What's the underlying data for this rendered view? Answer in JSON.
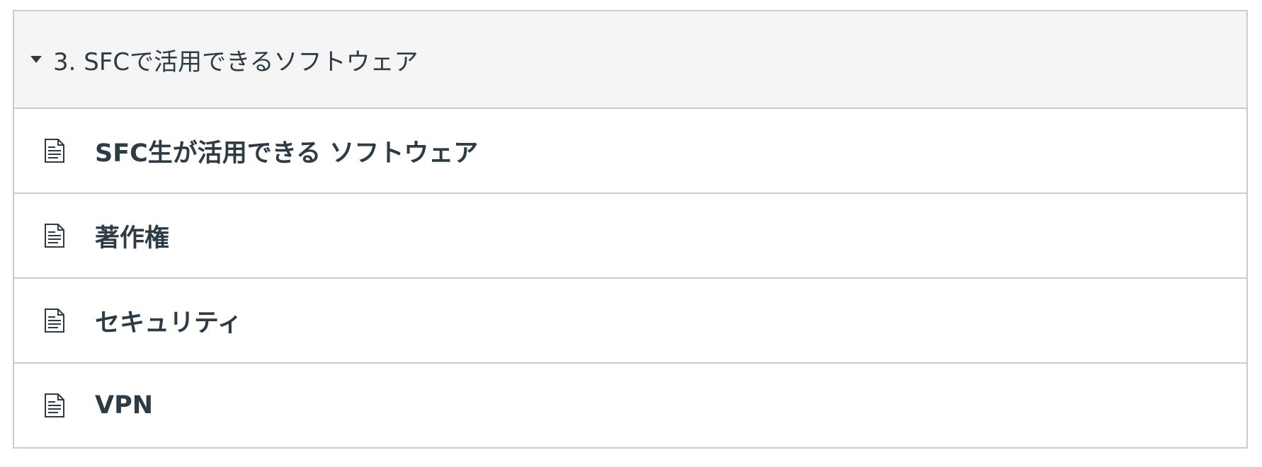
{
  "module": {
    "title": "3. SFCで活用できるソフトウェア",
    "expanded": true,
    "toggle_icon": "caret-down-icon",
    "items": [
      {
        "label": "SFC生が活用できる ソフトウェア",
        "icon": "document-icon"
      },
      {
        "label": "著作権",
        "icon": "document-icon"
      },
      {
        "label": "セキュリティ",
        "icon": "document-icon"
      },
      {
        "label": "VPN",
        "icon": "document-icon"
      }
    ]
  },
  "colors": {
    "text": "#2d3b45",
    "header_background": "#f5f5f5",
    "border": "#c7cdd1",
    "icon": "#2d3b45"
  }
}
